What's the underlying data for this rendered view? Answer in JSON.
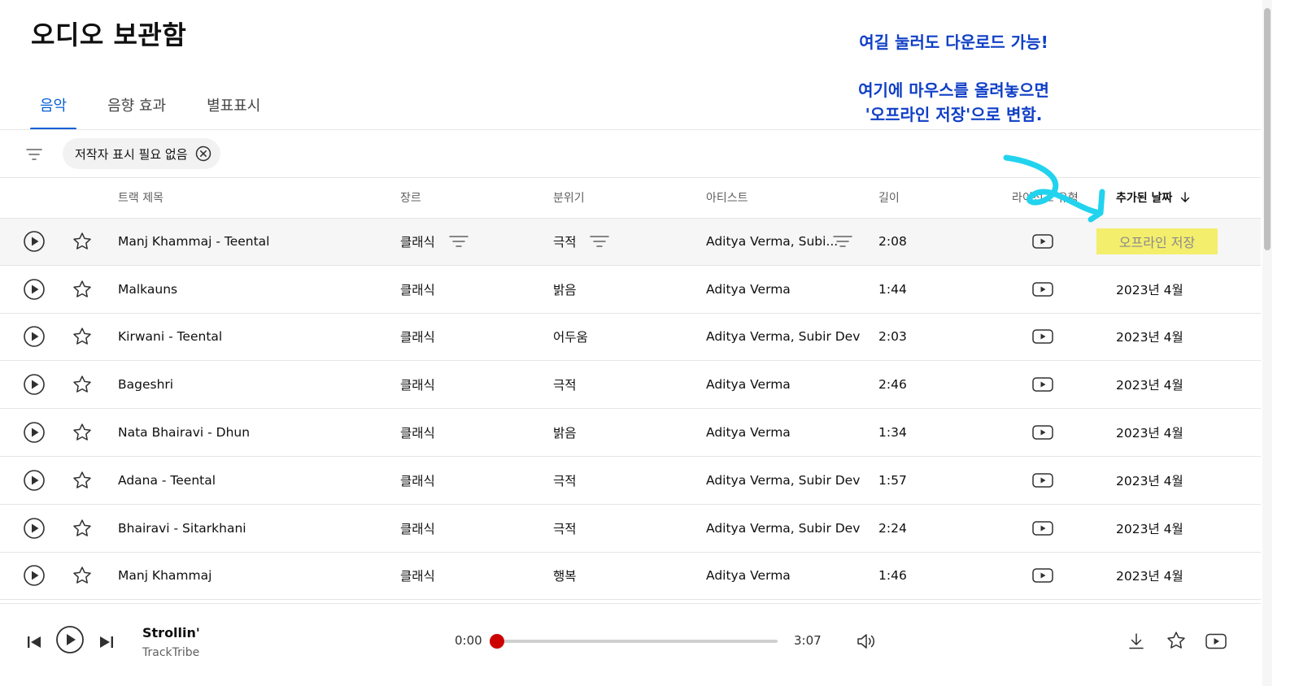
{
  "page": {
    "title": "오디오 보관함"
  },
  "tabs": [
    {
      "label": "음악",
      "active": true
    },
    {
      "label": "음향 효과",
      "active": false
    },
    {
      "label": "별표표시",
      "active": false
    }
  ],
  "filter_bar": {
    "chip_label": "저작자 표시 필요 없음"
  },
  "columns": {
    "title": "트랙 제목",
    "genre": "장르",
    "mood": "분위기",
    "artist": "아티스트",
    "length": "길이",
    "license": "라이선스 유형",
    "added": "추가된 날짜"
  },
  "tracks": [
    {
      "title": "Manj Khammaj - Teental",
      "genre": "클래식",
      "mood": "극적",
      "artist": "Aditya Verma, Subi...",
      "length": "2:08",
      "added": "오프라인 저장",
      "hovered": true
    },
    {
      "title": "Malkauns",
      "genre": "클래식",
      "mood": "밝음",
      "artist": "Aditya Verma",
      "length": "1:44",
      "added": "2023년 4월"
    },
    {
      "title": "Kirwani - Teental",
      "genre": "클래식",
      "mood": "어두움",
      "artist": "Aditya Verma, Subir Dev",
      "length": "2:03",
      "added": "2023년 4월"
    },
    {
      "title": "Bageshri",
      "genre": "클래식",
      "mood": "극적",
      "artist": "Aditya Verma",
      "length": "2:46",
      "added": "2023년 4월"
    },
    {
      "title": "Nata Bhairavi - Dhun",
      "genre": "클래식",
      "mood": "밝음",
      "artist": "Aditya Verma",
      "length": "1:34",
      "added": "2023년 4월"
    },
    {
      "title": "Adana - Teental",
      "genre": "클래식",
      "mood": "극적",
      "artist": "Aditya Verma, Subir Dev",
      "length": "1:57",
      "added": "2023년 4월"
    },
    {
      "title": "Bhairavi - Sitarkhani",
      "genre": "클래식",
      "mood": "극적",
      "artist": "Aditya Verma, Subir Dev",
      "length": "2:24",
      "added": "2023년 4월"
    },
    {
      "title": "Manj Khammaj",
      "genre": "클래식",
      "mood": "행복",
      "artist": "Aditya Verma",
      "length": "1:46",
      "added": "2023년 4월"
    }
  ],
  "player": {
    "track_title": "Strollin'",
    "track_artist": "TrackTribe",
    "current_time": "0:00",
    "total_time": "3:07",
    "progress": 0
  },
  "annotations": {
    "line1": "여길 눌러도 다운로드 가능!",
    "line2": "여기에 마우스를 올려놓으면",
    "line3": "'오프라인 저장'으로 변함."
  },
  "colors": {
    "accent": "#065fd4",
    "annotation": "#0f3fc6",
    "arrow": "#22d3ee",
    "highlight": "#f4ee6d",
    "progress": "#cc0000"
  },
  "icons": {
    "play": "play-circle-icon",
    "star": "star-outline-icon",
    "filter": "filter-lines-icon",
    "license": "youtube-icon",
    "prev": "skip-previous-icon",
    "next": "skip-next-icon",
    "volume": "volume-icon",
    "download": "download-icon",
    "close": "close-circle-icon",
    "sort": "arrow-down-icon"
  }
}
